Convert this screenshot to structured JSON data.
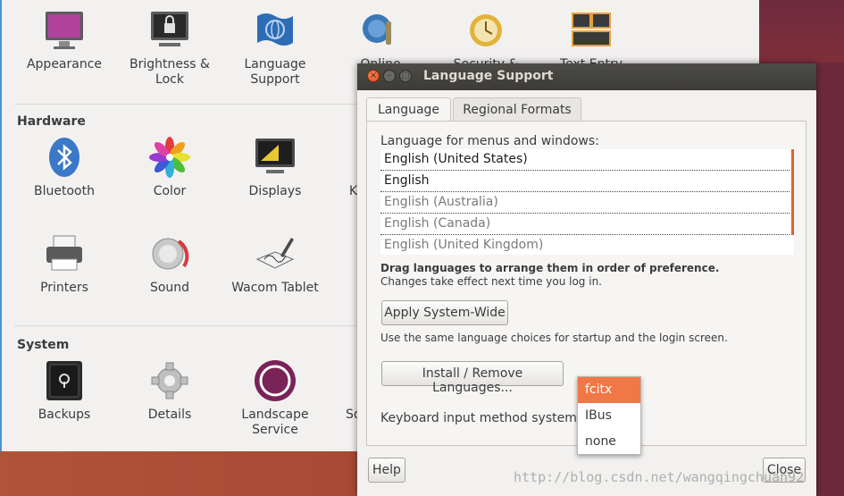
{
  "settings": {
    "personal_items": [
      {
        "label": "Appearance",
        "icon": "appearance-icon"
      },
      {
        "label": "Brightness & Lock",
        "icon": "brightness-lock-icon"
      },
      {
        "label": "Language Support",
        "icon": "language-support-icon"
      },
      {
        "label": "Online",
        "icon": "online-accounts-icon"
      },
      {
        "label": "Security &",
        "icon": "security-privacy-icon"
      },
      {
        "label": "Text Entry",
        "icon": "text-entry-icon"
      }
    ],
    "hardware_title": "Hardware",
    "hardware_items": [
      {
        "label": "Bluetooth",
        "icon": "bluetooth-icon"
      },
      {
        "label": "Color",
        "icon": "color-icon"
      },
      {
        "label": "Displays",
        "icon": "displays-icon"
      },
      {
        "label": "K",
        "icon": "keyboard-icon"
      },
      {
        "label": "Printers",
        "icon": "printer-icon"
      },
      {
        "label": "Sound",
        "icon": "sound-icon"
      },
      {
        "label": "Wacom Tablet",
        "icon": "wacom-tablet-icon"
      }
    ],
    "system_title": "System",
    "system_items": [
      {
        "label": "Backups",
        "icon": "backups-icon"
      },
      {
        "label": "Details",
        "icon": "details-icon"
      },
      {
        "label": "Landscape Service",
        "icon": "landscape-service-icon"
      },
      {
        "label": "So",
        "icon": "software-updates-icon"
      }
    ]
  },
  "dialog": {
    "title": "Language Support",
    "tabs": [
      {
        "label": "Language",
        "active": true
      },
      {
        "label": "Regional Formats",
        "active": false
      }
    ],
    "menus_label": "Language for menus and windows:",
    "languages": [
      {
        "name": "English (United States)",
        "style": "strong"
      },
      {
        "name": "English",
        "style": "strong"
      },
      {
        "name": "English (Australia)",
        "style": "dim"
      },
      {
        "name": "English (Canada)",
        "style": "dim"
      },
      {
        "name": "English (United Kingdom)",
        "style": "dim"
      }
    ],
    "drag_hint": "Drag languages to arrange them in order of preference.",
    "changes_hint": "Changes take effect next time you log in.",
    "apply_button": "Apply System-Wide",
    "apply_hint": "Use the same language choices for startup and the login screen.",
    "install_button": "Install / Remove Languages...",
    "input_method_label": "Keyboard input method system:",
    "input_method_options": [
      "fcitx",
      "IBus",
      "none"
    ],
    "input_method_selected": "fcitx",
    "help_button": "Help",
    "close_button": "Close"
  },
  "watermark": "http://blog.csdn.net/wangqingchuan92",
  "colors": {
    "accent": "#f07746",
    "titlebar": "#3c3b37"
  }
}
